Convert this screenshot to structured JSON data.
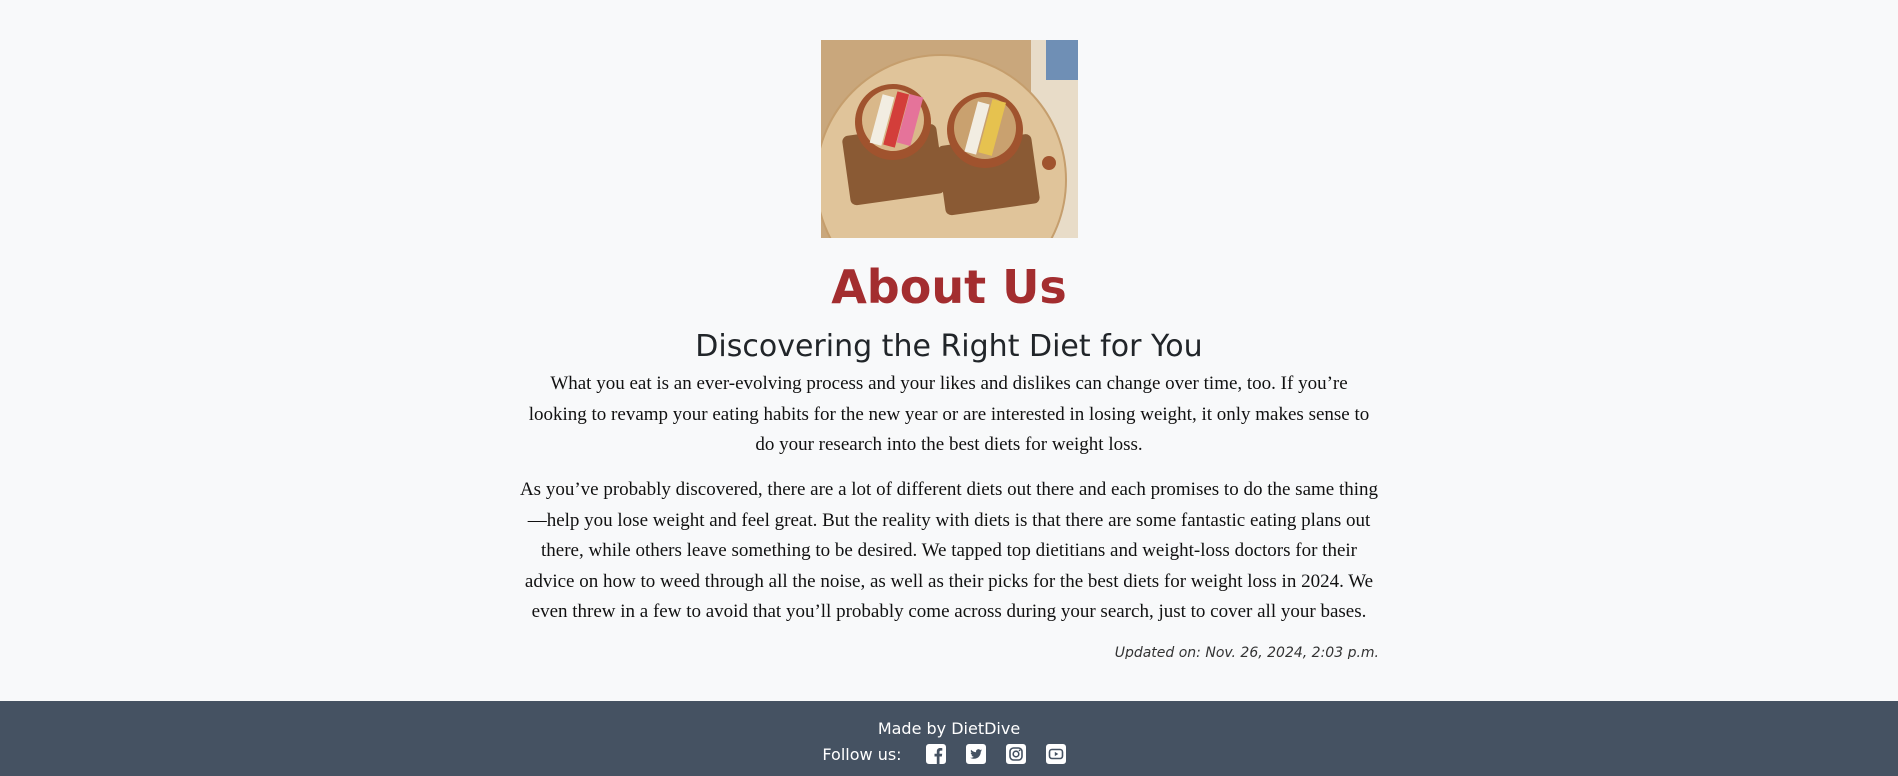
{
  "about": {
    "image_alt": "Two smoothie bowls on wooden boards",
    "title": "About Us",
    "subtitle": "Discovering the Right Diet for You",
    "paragraphs": [
      "What you eat is an ever-evolving process and your likes and dislikes can change over time, too. If you’re looking to revamp your eating habits for the new year or are interested in losing weight, it only makes sense to do your research into the best diets for weight loss.",
      "As you’ve probably discovered, there are a lot of different diets out there and each promises to do the same thing—help you lose weight and feel great. But the reality with diets is that there are some fantastic eating plans out there, while others leave something to be desired. We tapped top dietitians and weight-loss doctors for their advice on how to weed through all the noise, as well as their picks for the best diets for weight loss in 2024. We even threw in a few to avoid that you’ll probably come across during your search, just to cover all your bases."
    ],
    "updated": "Updated on: Nov. 26, 2024, 2:03 p.m."
  },
  "footer": {
    "made_by": "Made by DietDive",
    "follow_label": "Follow us:",
    "social_icons": [
      "facebook-icon",
      "twitter-icon",
      "instagram-icon",
      "youtube-icon"
    ]
  },
  "colors": {
    "title": "#a32d2f",
    "footer_bg": "#455262",
    "page_bg": "#f8f9fa"
  }
}
